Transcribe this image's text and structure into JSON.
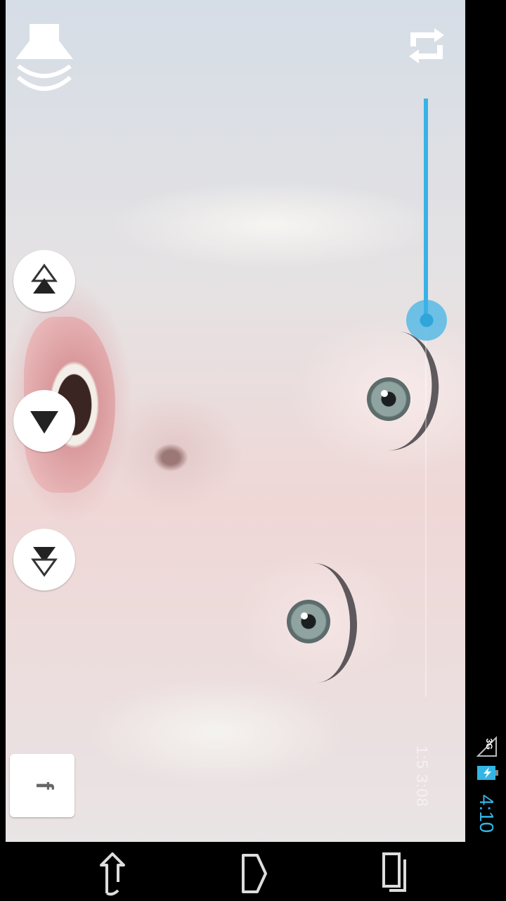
{
  "video": {
    "playback": {
      "elapsed": "1:5",
      "total": "3:08",
      "display": "1:5  3:08",
      "progress_fraction": 0.37
    }
  },
  "controls": {
    "volume_icon": "speaker-volume-icon",
    "repeat_icon": "repeat-icon",
    "previous_icon": "previous-icon",
    "play_icon": "play-icon",
    "next_icon": "next-icon",
    "share_icon": "facebook-icon",
    "share_label": "f",
    "seek_color": "#39b2e6"
  },
  "status_bar": {
    "network": "3G",
    "time": "4:10",
    "clock_color": "#33b5e5",
    "battery": "charging"
  },
  "nav_bar": {
    "back_icon": "back-icon",
    "home_icon": "home-icon",
    "recents_icon": "recents-icon"
  }
}
